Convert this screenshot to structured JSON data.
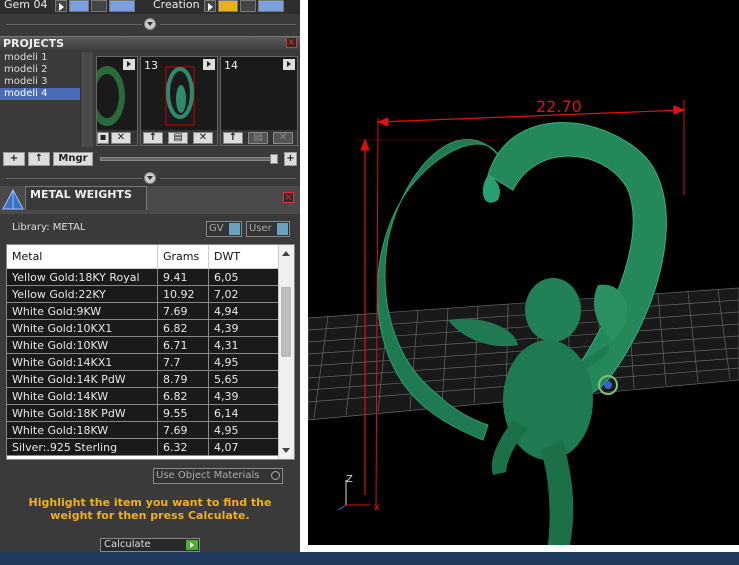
{
  "toolbar": {
    "gem_label": "Gem 04",
    "creation_label": "Creation"
  },
  "projects": {
    "title": "PROJECTS",
    "items": [
      "modeli 1",
      "modeli 2",
      "modeli 3",
      "modeli 4"
    ],
    "selected_index": 3,
    "thumbnails": [
      {
        "number": ""
      },
      {
        "number": "13"
      },
      {
        "number": "14"
      }
    ],
    "buttons": {
      "add": "+",
      "up": "↑",
      "manager": "Mngr",
      "zoom_plus": "+"
    }
  },
  "metal_weights": {
    "title": "METAL WEIGHTS",
    "library_label": "Library: METAL",
    "gv_label": "GV",
    "user_label": "User",
    "columns": [
      "Metal",
      "Grams",
      "DWT"
    ],
    "rows": [
      [
        "Yellow Gold:18KY Royal",
        "9.41",
        "6,05"
      ],
      [
        "Yellow Gold:22KY",
        "10.92",
        "7,02"
      ],
      [
        "White Gold:9KW",
        "7.69",
        "4,94"
      ],
      [
        "White Gold:10KX1",
        "6.82",
        "4,39"
      ],
      [
        "White Gold:10KW",
        "6.71",
        "4,31"
      ],
      [
        "White Gold:14KX1",
        "7.7",
        "4,95"
      ],
      [
        "White Gold:14K PdW",
        "8.79",
        "5,65"
      ],
      [
        "White Gold:14KW",
        "6.82",
        "4,39"
      ],
      [
        "White Gold:18K PdW",
        "9.55",
        "6,14"
      ],
      [
        "White Gold:18KW",
        "7.69",
        "4,95"
      ],
      [
        "Silver:.925 Sterling",
        "6.32",
        "4,07"
      ]
    ],
    "use_object_materials": "Use Object Materials",
    "hint": "Highlight the item you want to find the weight for then press Calculate.",
    "calculate_label": "Calculate"
  },
  "viewport": {
    "dimension_width": "22.70",
    "axis_z": "Z",
    "axis_x": "x",
    "colors": {
      "model": "#1f7a52",
      "dimension": "#e01010",
      "background": "#000000"
    }
  }
}
